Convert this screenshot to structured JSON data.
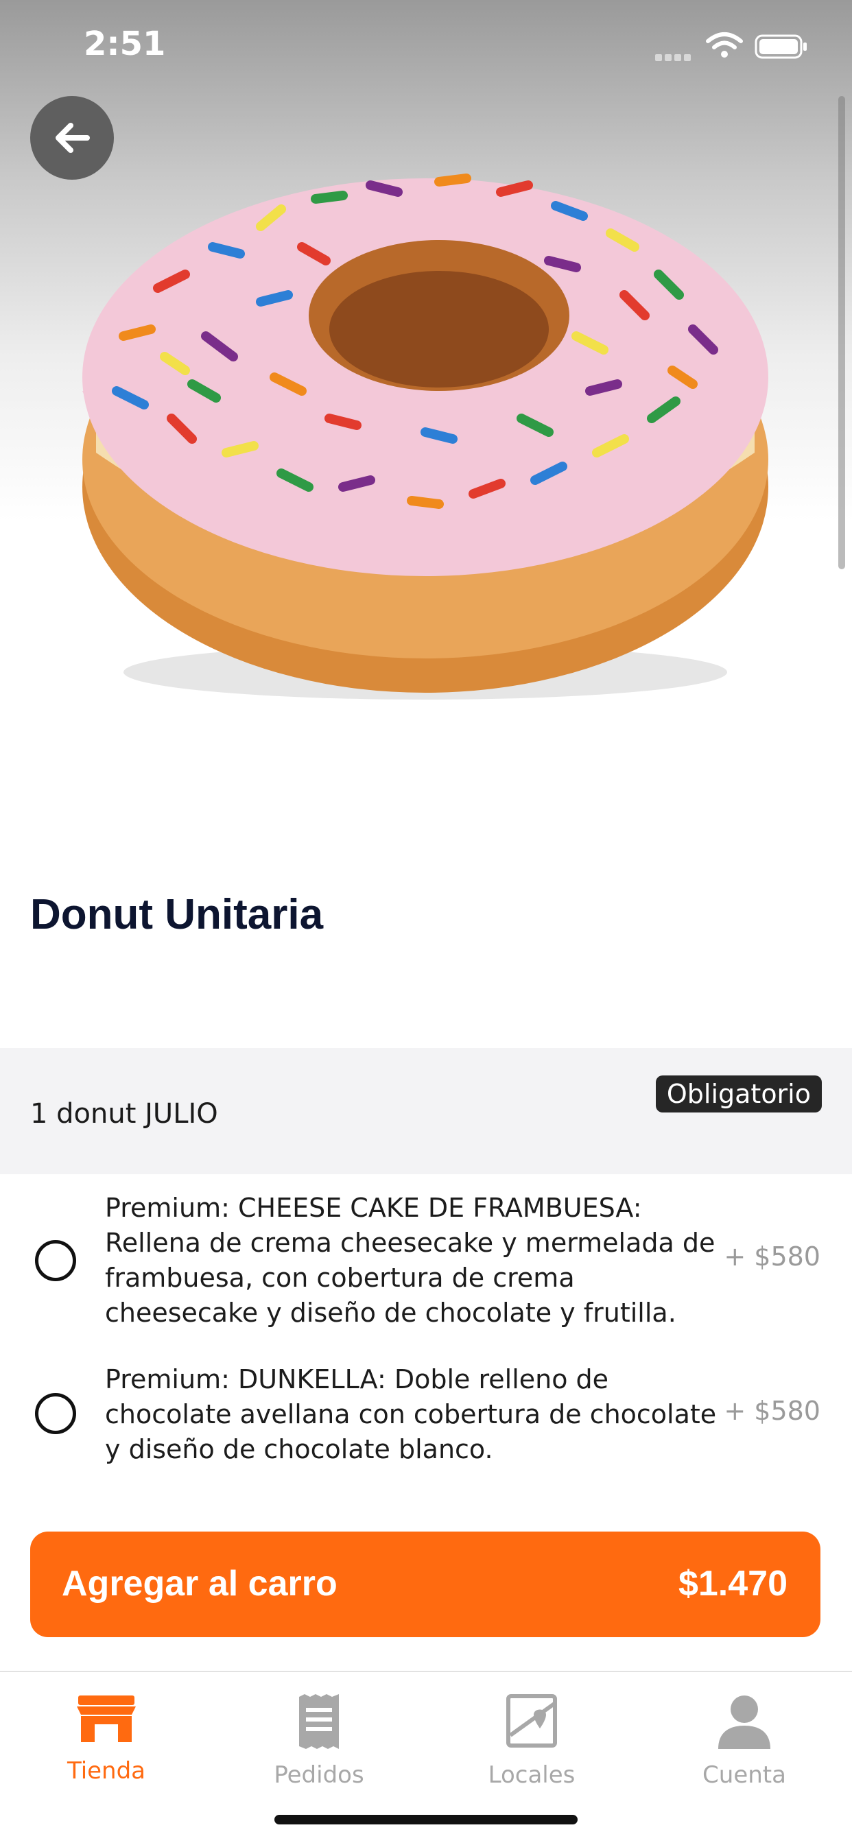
{
  "status_bar": {
    "time": "2:51"
  },
  "product": {
    "name": "Donut Unitaria",
    "image_icon": "donut-image"
  },
  "section": {
    "title": "1 donut JULIO",
    "badge": "Obligatorio"
  },
  "options": [
    {
      "text": "Premium: CHEESE CAKE DE FRAMBUESA: Rellena de crema cheesecake y mermelada de frambuesa, con cobertura de crema cheesecake y diseño de chocolate y frutilla.",
      "price": "+ $580",
      "selected": false
    },
    {
      "text": "Premium: DUNKELLA: Doble relleno de chocolate avellana con cobertura de chocolate y diseño de chocolate blanco.",
      "price": "+ $580",
      "selected": false
    }
  ],
  "cta": {
    "label": "Agregar al carro",
    "price": "$1.470"
  },
  "tabs": [
    {
      "label": "Tienda",
      "icon": "store-icon",
      "active": true
    },
    {
      "label": "Pedidos",
      "icon": "receipt-icon",
      "active": false
    },
    {
      "label": "Locales",
      "icon": "map-icon",
      "active": false
    },
    {
      "label": "Cuenta",
      "icon": "user-icon",
      "active": false
    }
  ],
  "colors": {
    "accent": "#ff6a10",
    "title": "#0d1530",
    "badge_bg": "#262626"
  }
}
